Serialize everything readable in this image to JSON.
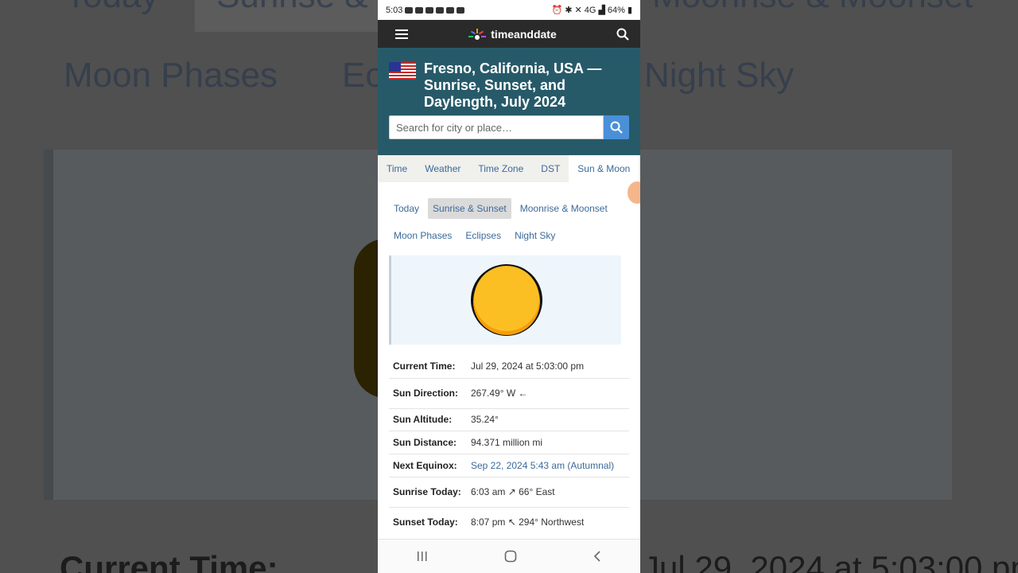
{
  "background": {
    "tab1": "Today",
    "tab2": "Sunrise & Sunset",
    "tab3": "Moonrise & Moonset",
    "link1": "Moon Phases",
    "link2": "Eclipses",
    "link3": "Night Sky",
    "bottom_label": "Current Time:",
    "bottom_value": "Jul 29, 2024 at 5:03:00 pm"
  },
  "status": {
    "time": "5:03",
    "network": "4G",
    "battery": "64%"
  },
  "app": {
    "brand": "timeanddate"
  },
  "hero": {
    "title": "Fresno, California, USA — Sunrise, Sunset, and Daylength, July 2024",
    "search_placeholder": "Search for city or place…"
  },
  "tabs": [
    "Time",
    "Weather",
    "Time Zone",
    "DST",
    "Sun & Moon"
  ],
  "subnav": [
    "Today",
    "Sunrise & Sunset",
    "Moonrise & Moonset",
    "Moon Phases",
    "Eclipses",
    "Night Sky"
  ],
  "info": {
    "current_time": {
      "label": "Current Time:",
      "value": "Jul 29, 2024 at 5:03:00 pm"
    },
    "sun_direction": {
      "label": "Sun Direction:",
      "value": "267.49° W",
      "arrow": "←"
    },
    "sun_altitude": {
      "label": "Sun Altitude:",
      "value": "35.24°"
    },
    "sun_distance": {
      "label": "Sun Distance:",
      "value": "94.371 million mi"
    },
    "next_equinox": {
      "label": "Next Equinox:",
      "value": "Sep 22, 2024 5:43 am (Autumnal)"
    },
    "sunrise": {
      "label": "Sunrise Today:",
      "time": "6:03 am",
      "arrow": "↗",
      "dir": "66° East"
    },
    "sunset": {
      "label": "Sunset Today:",
      "time": "8:07 pm",
      "arrow": "↖",
      "dir": "294° Northwest"
    }
  },
  "colors": {
    "hero": "#275a69",
    "appbar": "#2a2a2a",
    "link": "#3c6a9a",
    "sun": "#fbbf24"
  }
}
